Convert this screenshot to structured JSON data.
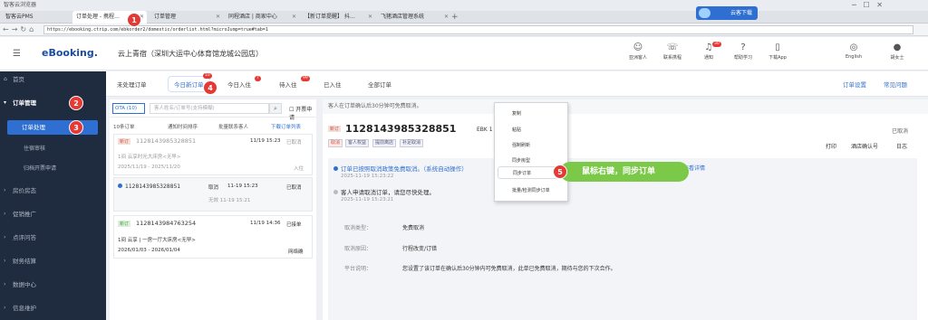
{
  "browser": {
    "title": "智客云浏览器",
    "tabs": [
      "智客云PMS",
      "订单处理 - 携程…",
      "订单管理",
      "同程酒店 | 商家中心",
      "【新订单提醒】 抖…",
      "飞猪酒店管理系统"
    ],
    "address": "https://ebooking.ctrip.com/ebkorder2/domestic/orderlist.html?microJump=true#tab=1",
    "cloud_download": "云客下载"
  },
  "header": {
    "logo": "eBooking.",
    "hotel": "云上青宿（深圳大运中心体育馆龙城公园店）",
    "items": [
      {
        "icon": "user-icon",
        "label": "亚洲客人"
      },
      {
        "icon": "phone-icon",
        "label": "联系携程"
      },
      {
        "icon": "bell-icon",
        "label": "通知",
        "badge": "30"
      },
      {
        "icon": "help-icon",
        "label": "帮助学习"
      },
      {
        "icon": "download-icon",
        "label": "下载App"
      },
      {
        "icon": "globe-icon",
        "label": "English"
      },
      {
        "icon": "avatar-icon",
        "label": "胡女士"
      }
    ]
  },
  "sidebar": {
    "items": [
      {
        "label": "首页"
      },
      {
        "label": "订单管理"
      },
      {
        "label": "订单处理"
      },
      {
        "label": "住宿审核"
      },
      {
        "label": "归档开票申请"
      },
      {
        "label": "房价房态"
      },
      {
        "label": "促销推广"
      },
      {
        "label": "点评问答"
      },
      {
        "label": "财务结算"
      },
      {
        "label": "数据中心"
      },
      {
        "label": "信息维护"
      }
    ]
  },
  "top_tabs": {
    "tabs": [
      {
        "label": "未处理订单"
      },
      {
        "label": "今日新订单",
        "badge": "10"
      },
      {
        "label": "今日入住",
        "badge": "7"
      },
      {
        "label": "待入住",
        "badge": "99"
      },
      {
        "label": "已入住"
      },
      {
        "label": "全部订单"
      }
    ],
    "links": [
      "订单设置",
      "常见问题"
    ]
  },
  "list": {
    "channel": "OTA (10)",
    "search_placeholder": "客人姓名/订单号(支持模糊)",
    "invoice_filter": "开票申请",
    "more": "更多",
    "reset": "重置",
    "count": "10条订单",
    "sort": "通知时间排序",
    "batch": "批量联系客人",
    "download": "下载订单列表",
    "orders": [
      {
        "tag": "新订",
        "order_no": "1128143985328851",
        "time": "11/19 15:23",
        "status": "已取消",
        "line1": "1间  云享时光大床房<无早>",
        "line2": "2025/11/19 - 2025/11/20",
        "line2_right": "入住"
      },
      {
        "tag": "",
        "order_no": "1128143985328851",
        "time": "11-19 15:23",
        "status": "已取消",
        "status_left": "取消",
        "line2": "无效  11-19 15:21",
        "line2_right": ""
      },
      {
        "tag": "新订",
        "order_no": "1128143984763254",
        "time": "11/19 14:36",
        "status": "已接单",
        "line1": "1间  云享 | 一房一厅大床房<无早>",
        "line2": "2026/01/03 - 2026/01/04",
        "line2_right": "网络确"
      }
    ]
  },
  "detail": {
    "notice": "客人在订单确认后30分钟可免费取消。",
    "tag": "新订",
    "order_no": "1128143985328851",
    "ebk": "EBK 1",
    "status": "已取消",
    "tags": [
      "取消",
      "客人权益",
      "提前离店",
      "补足取消"
    ],
    "actions": [
      "打印",
      "酒店确认号",
      "日志"
    ],
    "event1": "订单已按照取消政策免费取消。（系统自动操作）",
    "event1_time": "2025-11-19 15:23:22",
    "event2": "客人申请取消订单，请您尽快处理。",
    "event2_time": "2025-11-19 15:23:21",
    "view_detail": "查看详情",
    "rows": [
      {
        "k": "取消类型：",
        "v": "免费取消"
      },
      {
        "k": "取消原因：",
        "v": "行程改变/订错"
      },
      {
        "k": "平台说明：",
        "v": "您设置了该订单在确认后30分钟内可免费取消，此单已免费取消，期待与您的下次合作。"
      }
    ]
  },
  "context_menu": {
    "items": [
      "复制",
      "粘贴",
      "强制刷新",
      "同步房型",
      "同步订单",
      "批量/检测同步订单"
    ]
  },
  "annotations": {
    "steps": [
      "1",
      "2",
      "3",
      "4",
      "5"
    ],
    "callout": "鼠标右键，同步订单"
  }
}
